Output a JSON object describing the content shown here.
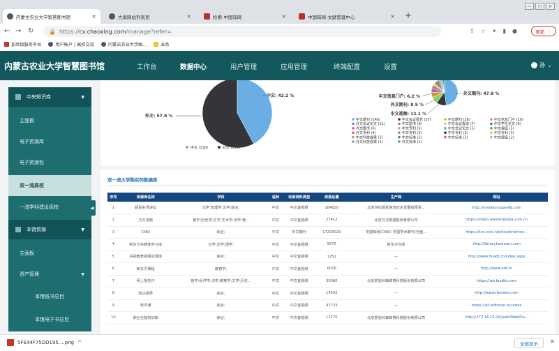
{
  "browser": {
    "tabs": [
      {
        "title": "内蒙古农业大学智慧图书馆"
      },
      {
        "title": "大屏网站列表页"
      },
      {
        "title": "检索-中国知网"
      },
      {
        "title": "中国知网-文献管理中心"
      }
    ],
    "url_scheme": "https://",
    "url_host": "cv.chaoxing.com",
    "url_path": "/manage?refer=",
    "update_label": "更新",
    "bookmarks": [
      "加项目服务平台",
      "用户帐户 | 高校交流",
      "内蒙古农业大学图...",
      "业务"
    ]
  },
  "header": {
    "logo": "内蒙古农业大学智慧图书馆",
    "menu": [
      "工作台",
      "数据中心",
      "用户管理",
      "应用管理",
      "终端配置",
      "设置"
    ],
    "active_menu": "数据中心",
    "user": "孙"
  },
  "sidebar": {
    "group1": "中央知识库",
    "items1": [
      "主面板",
      "电子资源库",
      "电子资源包",
      "双一流高校",
      "一流学科建设高校"
    ],
    "active": "双一流高校",
    "group2": "本馆资源",
    "items2": [
      "主面板",
      "资产管理"
    ],
    "sub2": [
      "本馆纸书总目",
      "本馆电子书总目"
    ]
  },
  "chart_data": [
    {
      "type": "pie",
      "slices": [
        {
          "label": "中文",
          "count": 130,
          "percent": 42.2,
          "color": "#6aaee6"
        },
        {
          "label": "外文",
          "count": 178,
          "percent": 57.8,
          "color": "#333539"
        }
      ],
      "slice_labels": [
        "中文: 42.2 %",
        "外文: 57.8 %"
      ],
      "legend": [
        "中文 (130)",
        "外文 (178)"
      ],
      "legend_position": "bottom"
    },
    {
      "type": "pie",
      "slice_labels": [
        "外文期刊: 47.9 %",
        "中文信息门户: 6.2 %",
        "外文期刊: 8.5 %",
        "中文视频: 12.1 %"
      ],
      "legend": [
        {
          "label": "中文期刊 (146)",
          "color": "#6aaee6"
        },
        {
          "label": "中文会议报告 (37)",
          "color": "#333539"
        },
        {
          "label": "中文期刊 (26)",
          "color": "#8dd069"
        },
        {
          "label": "中文信息门户 (19)",
          "color": "#e69035"
        },
        {
          "label": "外文会议论文 (11)",
          "color": "#7b79d1"
        },
        {
          "label": "中文图书 (9)",
          "color": "#e85a76"
        },
        {
          "label": "中文会议报道 (7)",
          "color": "#e0d35d"
        },
        {
          "label": "中文学位论文 (6)",
          "color": "#2c8a8a"
        },
        {
          "label": "外文图书 (6)",
          "color": "#e85a5a"
        },
        {
          "label": "中文专利 (5)",
          "color": "#7cc5cc"
        },
        {
          "label": "中文会议论文 (5)",
          "color": "#5aa5e6"
        },
        {
          "label": "中文报纸 (5)",
          "color": "#54a45e"
        },
        {
          "label": "外文专利 (4)",
          "color": "#9b6ccc"
        },
        {
          "label": "中文专利 (3)",
          "color": "#cc66aa"
        },
        {
          "label": "中文专利 (3)",
          "color": "#333539"
        },
        {
          "label": "中文专利 (3)",
          "color": "#e0c84a"
        },
        {
          "label": "中文科技成果 (2)",
          "color": "#e69035"
        },
        {
          "label": "中文标准 (2)",
          "color": "#2c8a8a"
        },
        {
          "label": "中文标准 (2)",
          "color": "#e85a5a"
        },
        {
          "label": "中文报纸 (2)",
          "color": "#7cc5cc"
        },
        {
          "label": "外文科技成果 (1)",
          "color": "#5aa5e6"
        },
        {
          "label": "外文标准 (1)",
          "color": "#54a45e"
        }
      ],
      "slices": [
        {
          "label": "外文期刊",
          "percent": 47.9,
          "color": "#6aaee6"
        },
        {
          "label": "中文视频",
          "percent": 12.1,
          "color": "#333539"
        },
        {
          "label": "外文期刊",
          "percent": 8.5,
          "color": "#8dd069"
        },
        {
          "label": "中文信息门户",
          "percent": 6.2,
          "color": "#e69035"
        },
        {
          "label": "",
          "percent": 5.0,
          "color": "#7b79d1"
        },
        {
          "label": "",
          "percent": 4.0,
          "color": "#e85a76"
        },
        {
          "label": "",
          "percent": 3.5,
          "color": "#e0d35d"
        },
        {
          "label": "",
          "percent": 3.0,
          "color": "#2c8a8a"
        },
        {
          "label": "",
          "percent": 2.8,
          "color": "#e85a5a"
        },
        {
          "label": "",
          "percent": 2.4,
          "color": "#7cc5cc"
        },
        {
          "label": "",
          "percent": 2.2,
          "color": "#5aa5e6"
        },
        {
          "label": "",
          "percent": 2.4,
          "color": "#54a45e"
        }
      ],
      "legend_position": "bottom"
    }
  ],
  "table": {
    "title": "双一流大学购买的数据库",
    "columns": [
      "序号",
      "资源库名称",
      "学科",
      "语种",
      "收录资料类型",
      "资源总量",
      "生产商",
      "网址"
    ],
    "rows": [
      [
        "1",
        "超星名师讲坛",
        "法学;管理学;文学;综合;",
        "中文",
        "中文音视频",
        "164820",
        "北京世纪超星信息技术发展有限责...",
        "http://ssvideo.superlib.com"
      ],
      [
        "2",
        "万方视频",
        "管学;历史学;文学;艺术学;法学;管...",
        "中文",
        "中文音视频",
        "27412",
        "北京万方数据股份有限公司",
        "https://video.wanfangdata.com.cn"
      ],
      [
        "3",
        "CNKI",
        "综合;",
        "中文",
        "中文期刊",
        "17293029",
        "中国知网(CNKI) 中国学术期刊(光盘...",
        "https://kns.cnki.net/kns/brief/res..."
      ],
      [
        "4",
        "新东方多媒体学习库",
        "文学;法学;理学;",
        "中文",
        "中文音视频",
        "9575",
        "新东方在线",
        "http://library.koolearn.com"
      ],
      [
        "5",
        "共视教育视频资源库",
        "综合;",
        "中文",
        "中文音视频",
        "1252",
        "—",
        "http://www.hnadl.cn/index.aspx"
      ],
      [
        "6",
        "新东方课程",
        "教育学;",
        "中文",
        "中文音视频",
        "6016",
        "—",
        "http://www.xdf.cn"
      ],
      [
        "7",
        "网上报告厅",
        "管学;经济学;法学;教育学;文学;历史...",
        "中文",
        "中文音视频",
        "30380",
        "北京爱迪科森教育科技股份有限公司",
        "https://wb.bjadks.com"
      ],
      [
        "8",
        "知识视界",
        "综合;",
        "中文",
        "中文音视频",
        "14502",
        "—",
        "http://www.libvideo.com"
      ],
      [
        "9",
        "软件通",
        "综合;",
        "中文",
        "中文音视频",
        "47733",
        "—",
        "https://zjt.softtone.cn/index"
      ],
      [
        "10",
        "职业全能培训库",
        "综合;",
        "中文",
        "中文音视频",
        "11170",
        "北京爱迪科森教育科技股份有限公司",
        "http://172.16.15.20/jsab/Web/Pla..."
      ]
    ]
  },
  "download": {
    "file": "5FE44F75DD195....png",
    "show_all": "全部显示"
  }
}
